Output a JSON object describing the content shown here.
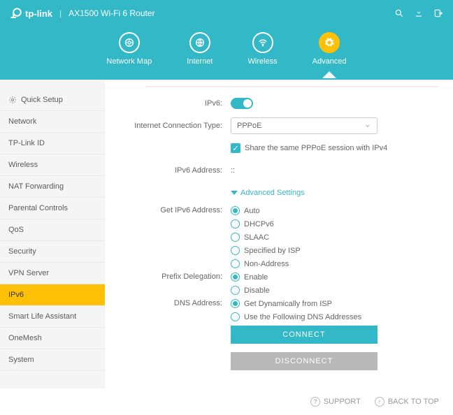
{
  "header": {
    "brand": "tp-link",
    "product": "AX1500 Wi-Fi 6 Router"
  },
  "nav": {
    "network_map": "Network Map",
    "internet": "Internet",
    "wireless": "Wireless",
    "advanced": "Advanced"
  },
  "sidebar": {
    "quick_setup": "Quick Setup",
    "network": "Network",
    "tplink_id": "TP-Link ID",
    "wireless": "Wireless",
    "nat": "NAT Forwarding",
    "parental": "Parental Controls",
    "qos": "QoS",
    "security": "Security",
    "vpn": "VPN Server",
    "ipv6": "IPv6",
    "smart": "Smart Life Assistant",
    "onemesh": "OneMesh",
    "system": "System"
  },
  "form": {
    "ipv6_label": "IPv6:",
    "conn_type_label": "Internet Connection Type:",
    "conn_type_value": "PPPoE",
    "share_session": "Share the same PPPoE session with IPv4",
    "ipv6_addr_label": "IPv6 Address:",
    "ipv6_addr_value": "::",
    "adv_settings": "Advanced Settings",
    "get_addr_label": "Get IPv6 Address:",
    "get_addr": {
      "auto": "Auto",
      "dhcpv6": "DHCPv6",
      "slaac": "SLAAC",
      "isp": "Specified by ISP",
      "nonaddr": "Non-Address"
    },
    "prefix_label": "Prefix Delegation:",
    "prefix": {
      "enable": "Enable",
      "disable": "Disable"
    },
    "dns_label": "DNS Address:",
    "dns": {
      "dyn": "Get Dynamically from ISP",
      "manual": "Use the Following DNS Addresses"
    },
    "connect": "CONNECT",
    "disconnect": "DISCONNECT"
  },
  "footer": {
    "support": "SUPPORT",
    "back_to_top": "BACK TO TOP"
  }
}
